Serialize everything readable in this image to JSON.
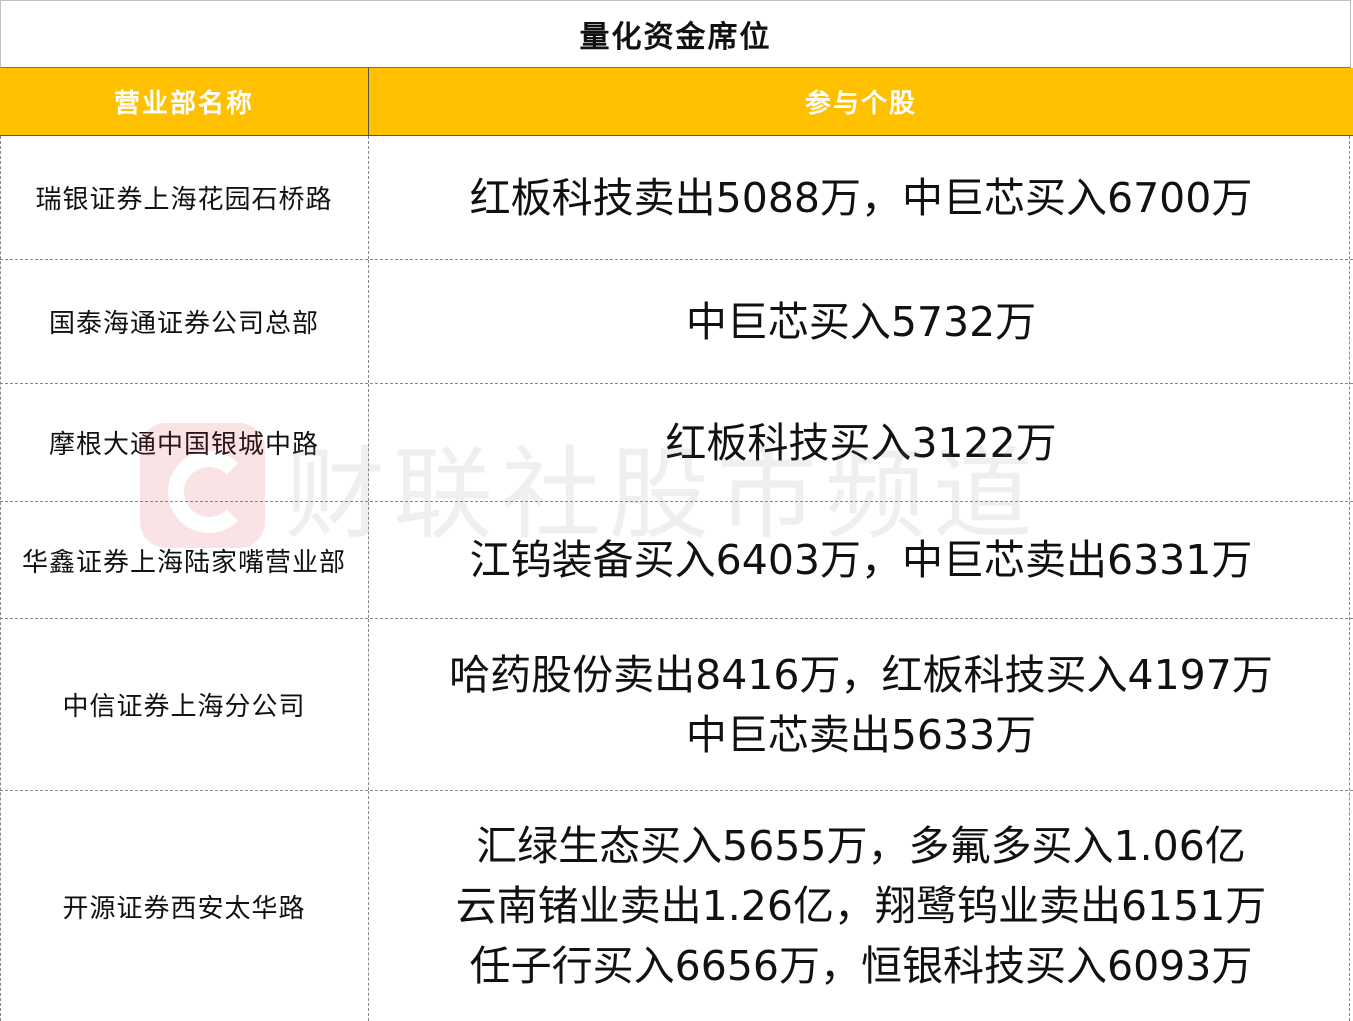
{
  "table": {
    "title": "量化资金席位",
    "headers": [
      "营业部名称",
      "参与个股"
    ],
    "rows": [
      {
        "name": "瑞银证券上海花园石桥路",
        "lines": [
          "红板科技卖出5088万，中巨芯买入6700万"
        ]
      },
      {
        "name": "国泰海通证券公司总部",
        "lines": [
          "中巨芯买入5732万"
        ]
      },
      {
        "name": "摩根大通中国银城中路",
        "lines": [
          "红板科技买入3122万"
        ]
      },
      {
        "name": "华鑫证券上海陆家嘴营业部",
        "lines": [
          "江钨装备买入6403万，中巨芯卖出6331万"
        ]
      },
      {
        "name": "中信证券上海分公司",
        "lines": [
          "哈药股份卖出8416万，红板科技买入4197万",
          "中巨芯卖出5633万"
        ]
      },
      {
        "name": "开源证券西安太华路",
        "lines": [
          "汇绿生态买入5655万，多氟多买入1.06亿",
          "云南锗业卖出1.26亿，翔鹭钨业卖出6151万",
          "任子行买入6656万，恒银科技买入6093万"
        ]
      }
    ]
  },
  "watermark": {
    "text": "财联社股市频道",
    "icon": "cls-logo-icon"
  }
}
